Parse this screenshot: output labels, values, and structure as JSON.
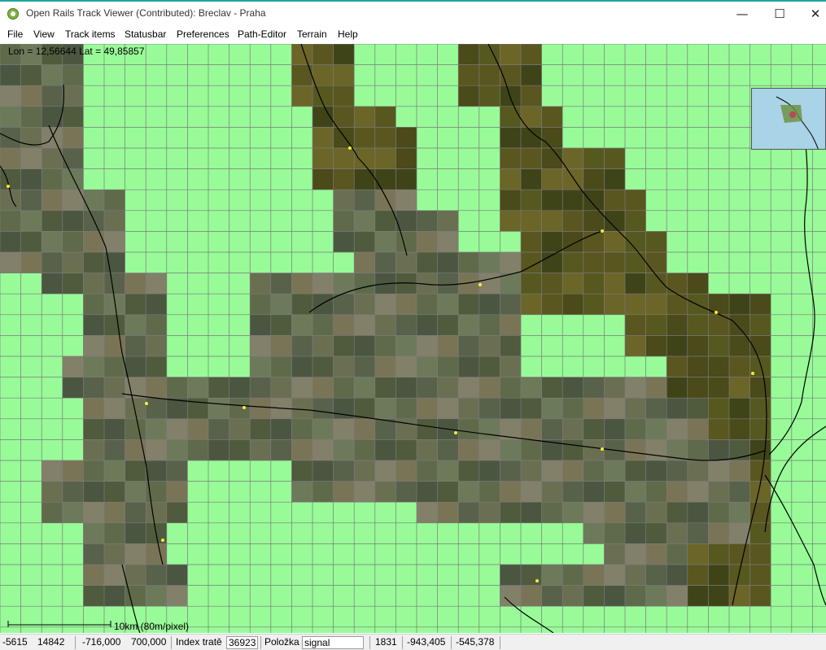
{
  "window": {
    "title": "Open Rails Track Viewer (Contributed): Breclav - Praha",
    "minimize_glyph": "—",
    "maximize_glyph": "☐",
    "close_glyph": "✕"
  },
  "menu": [
    "File",
    "View",
    "Track items",
    "Statusbar",
    "Preferences",
    "Path-Editor",
    "Terrain",
    "Help"
  ],
  "map": {
    "coordinates": "Lon = 12,56644  Lat = 49,85857",
    "scale_label": "10km (80m/pixel)"
  },
  "status": {
    "tile_x": "-5615",
    "tile_z": "14842",
    "world_x": "-716,000",
    "world_z": "700,000",
    "track_index_label": "Index tratě",
    "track_index_value": "36923",
    "item_label": "Položka",
    "item_value": "signal",
    "item_number": "1831",
    "item_x": "-943,405",
    "item_z": "-545,378"
  },
  "colors": {
    "background_tile": "#98fb98",
    "grid_line": "#7a7a7a",
    "track_line": "#000000",
    "accent_titlebar": "#1ba7a4"
  },
  "icons": [
    "app-icon",
    "minimize-icon",
    "maximize-icon",
    "close-icon"
  ]
}
